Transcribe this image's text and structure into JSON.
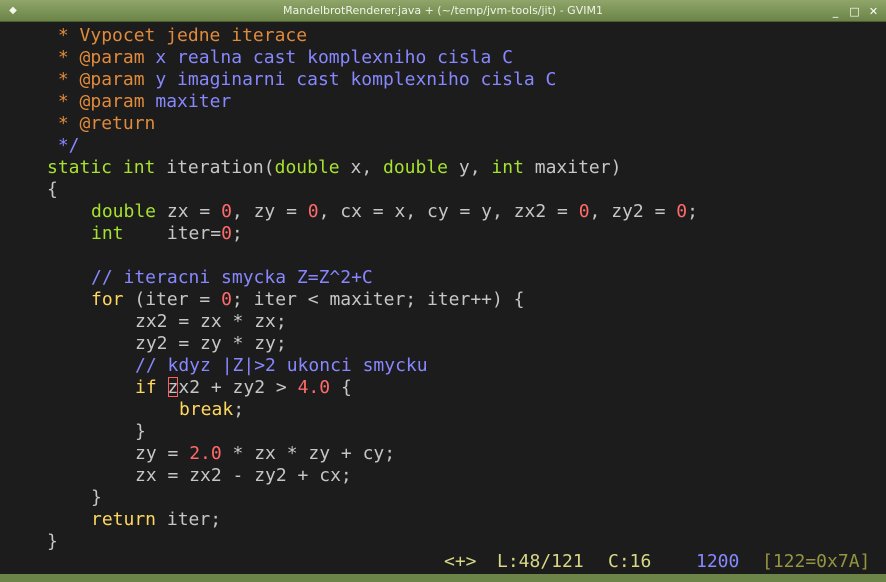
{
  "window": {
    "title": "MandelbrotRenderer.java + (~/temp/jvm-tools/jit) - GVIM1",
    "menu_glyph": "◆",
    "minimize_glyph": "_",
    "maximize_glyph": "□",
    "close_glyph": "✕"
  },
  "editor": {
    "lines": [
      {
        "indent": "  ",
        "tokens": [
          [
            "star",
            " * "
          ],
          [
            "star",
            "Vypocet jedne iterace"
          ]
        ]
      },
      {
        "indent": "  ",
        "tokens": [
          [
            "star",
            " * "
          ],
          [
            "star",
            "@param"
          ],
          [
            "cmt",
            " x realna cast komplexniho cisla C"
          ]
        ]
      },
      {
        "indent": "  ",
        "tokens": [
          [
            "star",
            " * "
          ],
          [
            "star",
            "@param"
          ],
          [
            "cmt",
            " y imaginarni cast komplexniho cisla C"
          ]
        ]
      },
      {
        "indent": "  ",
        "tokens": [
          [
            "star",
            " * "
          ],
          [
            "star",
            "@param"
          ],
          [
            "cmt",
            " maxiter"
          ]
        ]
      },
      {
        "indent": "  ",
        "tokens": [
          [
            "star",
            " * "
          ],
          [
            "star",
            "@return"
          ]
        ]
      },
      {
        "indent": "  ",
        "tokens": [
          [
            "cmt",
            " */"
          ]
        ]
      },
      {
        "indent": "  ",
        "tokens": [
          [
            "kw",
            "static"
          ],
          [
            "op",
            " "
          ],
          [
            "kw",
            "int"
          ],
          [
            "id",
            " iteration("
          ],
          [
            "kw",
            "double"
          ],
          [
            "id",
            " x, "
          ],
          [
            "kw",
            "double"
          ],
          [
            "id",
            " y, "
          ],
          [
            "kw",
            "int"
          ],
          [
            "id",
            " maxiter)"
          ]
        ]
      },
      {
        "indent": "  ",
        "tokens": [
          [
            "op",
            "{"
          ]
        ]
      },
      {
        "indent": "    ",
        "tokens": [
          [
            "kw",
            "double"
          ],
          [
            "id",
            " zx = "
          ],
          [
            "num",
            "0"
          ],
          [
            "id",
            ", zy = "
          ],
          [
            "num",
            "0"
          ],
          [
            "id",
            ", cx = x, cy = y, zx2 = "
          ],
          [
            "num",
            "0"
          ],
          [
            "id",
            ", zy2 = "
          ],
          [
            "num",
            "0"
          ],
          [
            "id",
            ";"
          ]
        ]
      },
      {
        "indent": "    ",
        "tokens": [
          [
            "kw",
            "int"
          ],
          [
            "id",
            "    iter="
          ],
          [
            "num",
            "0"
          ],
          [
            "id",
            ";"
          ]
        ]
      },
      {
        "indent": "",
        "tokens": []
      },
      {
        "indent": "    ",
        "tokens": [
          [
            "cmt",
            "// iteracni smycka Z=Z^2+C"
          ]
        ]
      },
      {
        "indent": "    ",
        "tokens": [
          [
            "special",
            "for"
          ],
          [
            "id",
            " (iter = "
          ],
          [
            "num",
            "0"
          ],
          [
            "id",
            "; iter < maxiter; iter++) {"
          ]
        ]
      },
      {
        "indent": "      ",
        "tokens": [
          [
            "id",
            "zx2 = zx * zx;"
          ]
        ]
      },
      {
        "indent": "      ",
        "tokens": [
          [
            "id",
            "zy2 = zy * zy;"
          ]
        ]
      },
      {
        "indent": "      ",
        "tokens": [
          [
            "cmt",
            "// kdyz |Z|>2 ukonci smycku"
          ]
        ]
      },
      {
        "indent": "      ",
        "tokens": [
          [
            "special",
            "if"
          ],
          [
            "id",
            " "
          ],
          [
            "cursor",
            "z"
          ],
          [
            "id",
            "x2 + zy2 > "
          ],
          [
            "num",
            "4.0"
          ],
          [
            "id",
            " {"
          ]
        ]
      },
      {
        "indent": "        ",
        "tokens": [
          [
            "special",
            "break"
          ],
          [
            "id",
            ";"
          ]
        ]
      },
      {
        "indent": "      ",
        "tokens": [
          [
            "id",
            "}"
          ]
        ]
      },
      {
        "indent": "      ",
        "tokens": [
          [
            "id",
            "zy = "
          ],
          [
            "num",
            "2.0"
          ],
          [
            "id",
            " * zx * zy + cy;"
          ]
        ]
      },
      {
        "indent": "      ",
        "tokens": [
          [
            "id",
            "zx = zx2 - zy2 + cx;"
          ]
        ]
      },
      {
        "indent": "    ",
        "tokens": [
          [
            "id",
            "}"
          ]
        ]
      },
      {
        "indent": "    ",
        "tokens": [
          [
            "special",
            "return"
          ],
          [
            "id",
            " iter;"
          ]
        ]
      },
      {
        "indent": "  ",
        "tokens": [
          [
            "op",
            "}"
          ]
        ]
      }
    ]
  },
  "statusline": {
    "modified": "<+>",
    "line": "L:48/121",
    "column": "C:16",
    "bytes": "1200",
    "char_code": "[122=0x7A]"
  }
}
